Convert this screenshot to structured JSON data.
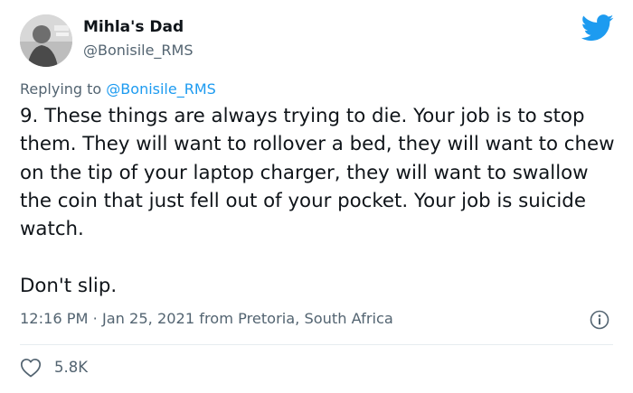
{
  "tweet": {
    "author_name": "Mihla's Dad",
    "author_handle": "@Bonisile_RMS",
    "avatar_icon": "user-avatar-photo",
    "brand_icon": "twitter-bird-icon",
    "brand_color": "#1d9bf0",
    "replying_prefix": "Replying to",
    "replying_to": "@Bonisile_RMS",
    "text": "9. These things are always trying to die. Your job is to stop them. They will want to rollover a bed, they will want to chew on the tip of your laptop charger, they will want to swallow the coin that just fell out of your pocket. Your job is suicide watch.\n\nDon't slip.",
    "timestamp": "12:16 PM · Jan 25, 2021 from Pretoria, South Africa",
    "info_icon": "info-icon",
    "like_icon": "heart-icon",
    "like_count": "5.8K"
  }
}
